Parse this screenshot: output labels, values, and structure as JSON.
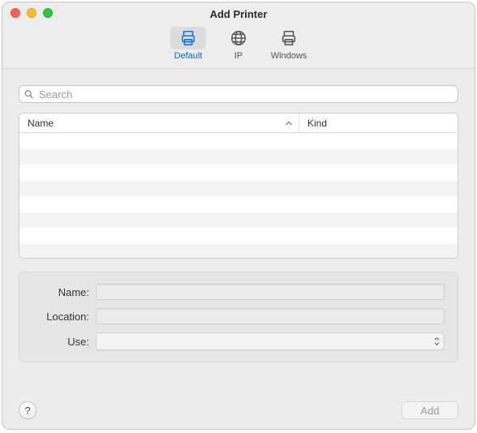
{
  "window": {
    "title": "Add Printer"
  },
  "toolbar": {
    "items": [
      {
        "id": "default",
        "label": "Default",
        "icon": "printer-icon",
        "selected": true
      },
      {
        "id": "ip",
        "label": "IP",
        "icon": "globe-icon",
        "selected": false
      },
      {
        "id": "windows",
        "label": "Windows",
        "icon": "printer-alt-icon",
        "selected": false
      }
    ]
  },
  "search": {
    "placeholder": "Search",
    "value": ""
  },
  "list": {
    "columns": [
      {
        "id": "name",
        "label": "Name",
        "sort": "asc"
      },
      {
        "id": "kind",
        "label": "Kind"
      }
    ],
    "rows": []
  },
  "form": {
    "name_label": "Name:",
    "name_value": "",
    "location_label": "Location:",
    "location_value": "",
    "use_label": "Use:",
    "use_value": ""
  },
  "footer": {
    "help_label": "?",
    "add_label": "Add",
    "add_enabled": false
  },
  "colors": {
    "accent": "#0a63d6",
    "window_bg": "#ececec",
    "separator": "#d6d6d6"
  }
}
